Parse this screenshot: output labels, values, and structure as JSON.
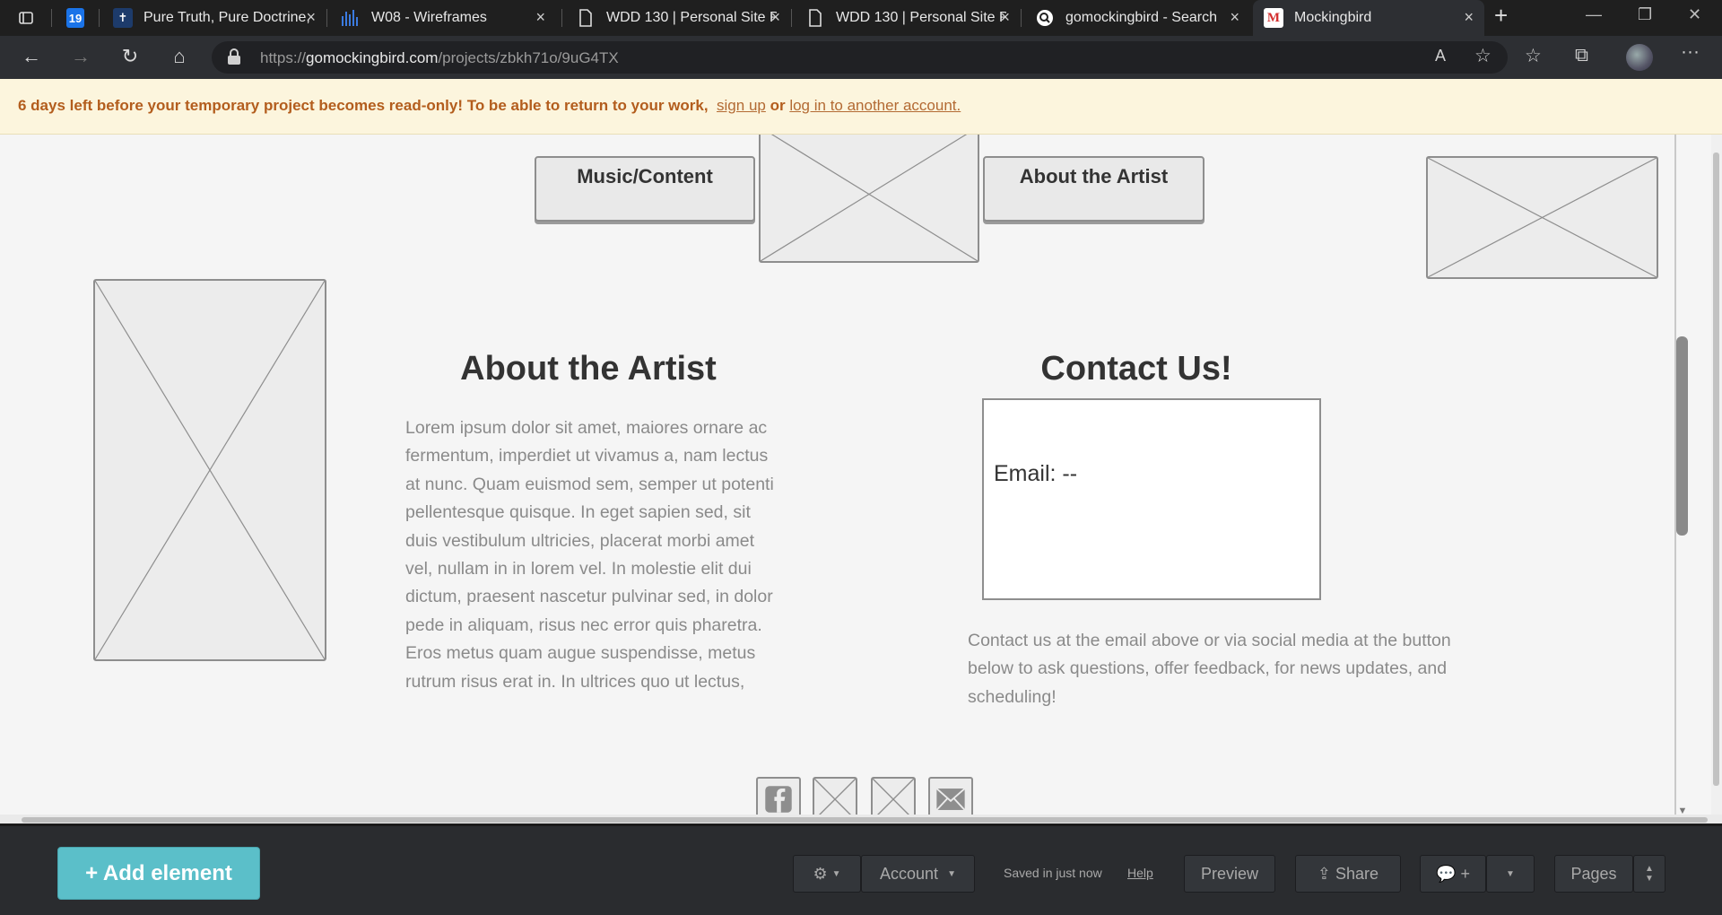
{
  "browser": {
    "tabs": [
      {
        "label": "",
        "favicon": "calendar-icon"
      },
      {
        "label": "Pure Truth, Pure Doctrine, ...",
        "favicon": "cross-icon"
      },
      {
        "label": "W08 - Wireframes",
        "favicon": "bars-icon"
      },
      {
        "label": "WDD 130 | Personal Site Pl...",
        "favicon": "document-icon"
      },
      {
        "label": "WDD 130 | Personal Site Pl...",
        "favicon": "document-icon"
      },
      {
        "label": "gomockingbird - Search",
        "favicon": "search-icon"
      },
      {
        "label": "Mockingbird",
        "favicon": "m-icon"
      }
    ],
    "favicon_glyphs": {
      "calendar": "19",
      "m": "M"
    },
    "url_scheme": "https://",
    "url_host": "gomockingbird.com",
    "url_path": "/projects/zbkh71o/9uG4TX"
  },
  "notice": {
    "text": "6 days left before your temporary project becomes read-only! To be able to return to your work,",
    "signup_link": "sign up",
    "or_text": "or",
    "login_link": "log in to another account."
  },
  "canvas": {
    "nav_buttons": [
      "Music/Content",
      "About the Artist"
    ],
    "about_heading": "About the Artist",
    "about_body": "Lorem ipsum dolor sit amet, maiores ornare ac fermentum, imperdiet ut vivamus a, nam lectus at nunc. Quam euismod sem, semper ut potenti pellentesque quisque. In eget sapien sed, sit duis vestibulum ultricies, placerat morbi amet vel, nullam in in lorem vel. In molestie elit dui dictum, praesent nascetur pulvinar sed, in dolor pede in aliquam, risus nec error quis pharetra. Eros metus quam augue suspendisse, metus rutrum risus erat in.  In ultrices quo ut lectus,",
    "contact_heading": "Contact Us!",
    "email_text": "Email: --",
    "contact_body": "Contact us at the email above or via social media at the button below to ask questions, offer feedback, for news updates, and scheduling!"
  },
  "toolbar": {
    "add_element": "+ Add element",
    "account": "Account",
    "saved_status": "Saved in just now",
    "help": "Help",
    "preview": "Preview",
    "share": "Share",
    "comment_plus": "+",
    "pages": "Pages"
  }
}
